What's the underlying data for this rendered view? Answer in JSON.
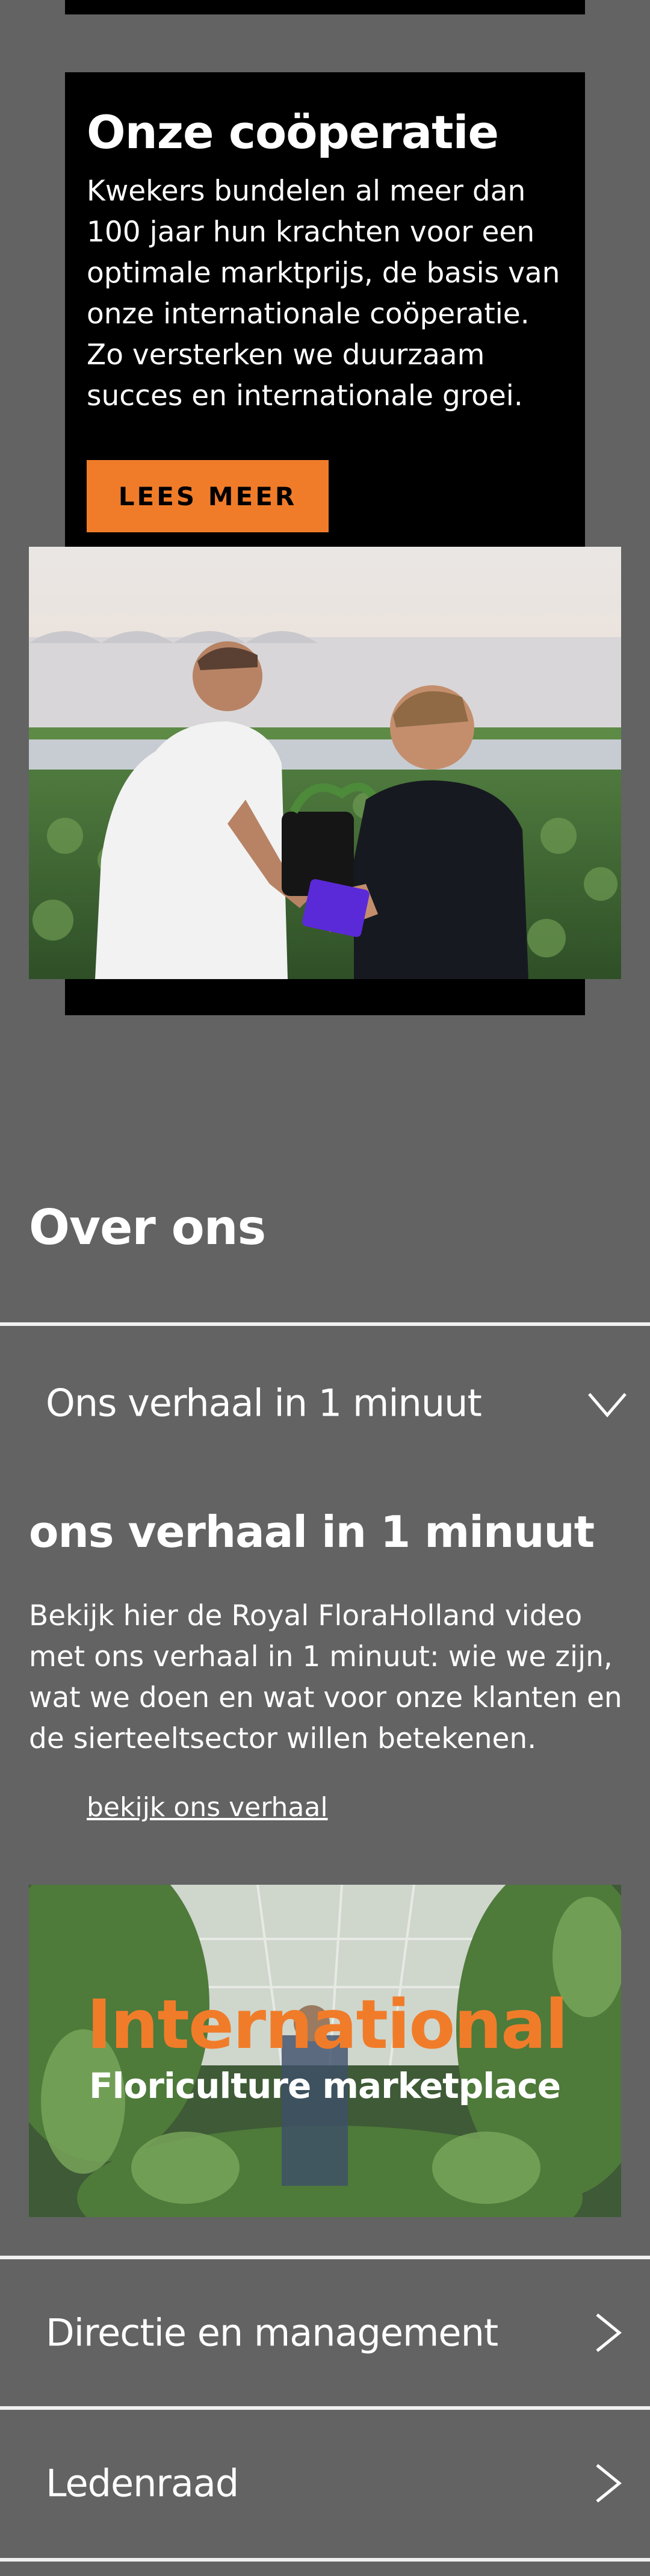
{
  "cooperation": {
    "title": "Onze coöperatie",
    "text": "Kwekers bundelen al meer dan 100 jaar hun krachten voor een optimale marktprijs, de basis van onze internationale coöperatie. Zo versterken we duurzaam succes en internationale groei.",
    "button_label": "LEES MEER"
  },
  "about": {
    "title": "Over ons",
    "accordion": [
      {
        "label": "Ons verhaal in 1 minuut",
        "icon": "chevron-down-icon",
        "expanded": true
      },
      {
        "label": "Directie en management",
        "icon": "chevron-right-icon",
        "expanded": false
      },
      {
        "label": "Ledenraad",
        "icon": "chevron-right-icon",
        "expanded": false
      }
    ],
    "story": {
      "title": "ons verhaal in 1 minuut",
      "text": "Bekijk hier de Royal FloraHolland video met ons verhaal in 1 minuut: wie we zijn, wat we doen en wat voor onze klanten en de sierteeltsector willen betekenen.",
      "link_label": "bekijk ons verhaal"
    },
    "video": {
      "title_line1": "International",
      "title_line2": "Floriculture marketplace"
    }
  },
  "colors": {
    "accent": "#f07c2a",
    "background": "#636363",
    "card": "#000000"
  }
}
